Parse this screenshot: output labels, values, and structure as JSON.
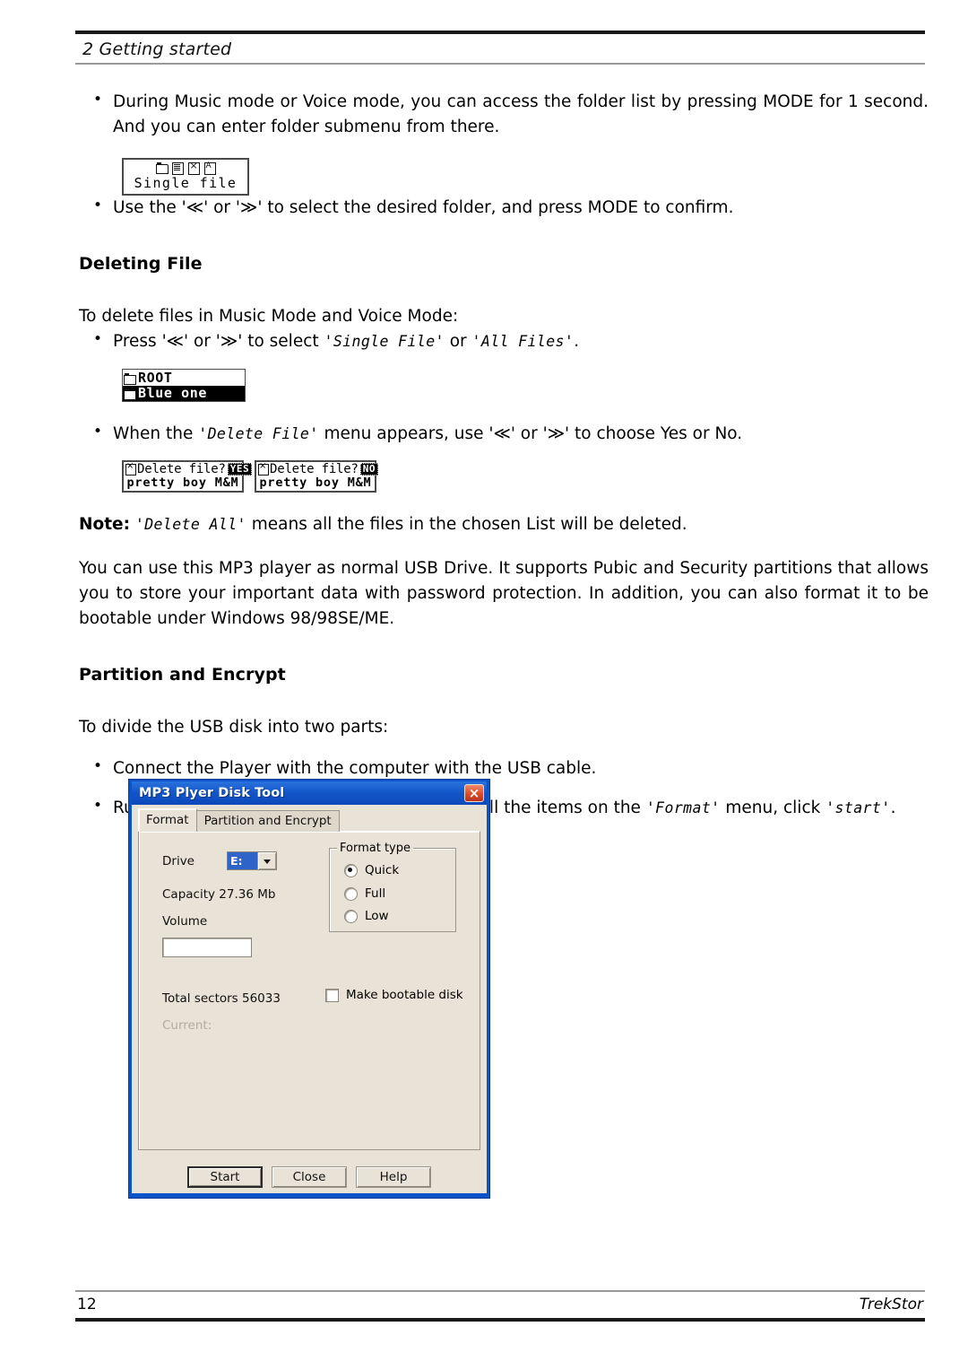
{
  "header": {
    "chapter_title": "2  Getting started"
  },
  "footer": {
    "page_number": "12",
    "brand": "TrekStor"
  },
  "body": {
    "bullet_folder_list_1": "During Music mode or Voice mode, you can access the folder list by pressing MODE for 1 second. And you can enter folder submenu from there.",
    "bullet_select_folder": "Use the '≪' or '≫' to select the desired folder, and press MODE to confirm.",
    "heading_deleting_file": "Deleting File",
    "intro_delete": "To delete files in Music Mode and Voice Mode:",
    "bullet_press_select_pre": "Press '≪' or '≫' to select ",
    "bullet_press_single_file": "'Single File'",
    "bullet_press_or": " or ",
    "bullet_press_all_files": "'All Files'",
    "bullet_press_end": ".",
    "bullet_delete_menu_pre": "When the ",
    "bullet_delete_menu_mono": "'Delete File'",
    "bullet_delete_menu_post": " menu appears, use '≪' or '≫' to choose Yes or No.",
    "note_label": "Note:",
    "note_mono": "'Delete All'",
    "note_rest": " means all the files in the chosen List will be deleted.",
    "usb_paragraph": "You can use this MP3 player as normal USB Drive. It supports Pubic and Security partitions that allows you to store your important data with password protection. In addition, you can also format it to be bootable under Windows 98/98SE/ME.",
    "heading_partition_encrypt": "Partition and Encrypt",
    "intro_divide": "To divide the USB disk into two parts:",
    "bullet_connect": "Connect the Player with the computer with the USB cable.",
    "bullet_run_tool_pre": "Run the MP3 Player Disk Tool. After filling in all the items on the ",
    "bullet_run_tool_format": "'Format'",
    "bullet_run_tool_mid": " menu, click ",
    "bullet_run_tool_start": "'start'",
    "bullet_run_tool_end": "."
  },
  "lcd_folder_list": {
    "caption": "Single file",
    "icons": [
      "folder-icon",
      "document-icon",
      "document-x-icon",
      "document-a-icon"
    ]
  },
  "lcd_root": {
    "root_label": "ROOT",
    "selected_label": "Blue one"
  },
  "lcd_delete_yes": {
    "prompt": "Delete file?",
    "choice": "YES",
    "track": "pretty boy M&M"
  },
  "lcd_delete_no": {
    "prompt": "Delete file?",
    "choice": "NO",
    "track": "pretty boy M&M"
  },
  "dialog": {
    "title": "MP3 Plyer Disk Tool",
    "close_glyph": "×",
    "tabs": [
      {
        "label": "Format",
        "active": true
      },
      {
        "label": "Partition and Encrypt",
        "active": false
      }
    ],
    "drive_label": "Drive",
    "drive_value": "E:",
    "capacity": "Capacity 27.36 Mb",
    "volume_label": "Volume",
    "volume_value": "",
    "volume_placeholder": "",
    "total_sectors": "Total sectors 56033",
    "current_label": "Current:",
    "format_type_title": "Format type",
    "format_type_options": [
      {
        "label": "Quick",
        "selected": true
      },
      {
        "label": "Full",
        "selected": false
      },
      {
        "label": "Low",
        "selected": false
      }
    ],
    "bootable_label": "Make bootable disk",
    "bootable_checked": false,
    "buttons": {
      "start": "Start",
      "close": "Close",
      "help": "Help"
    },
    "colors": {
      "titlebar": "#1255c8",
      "face": "#e8e3d6",
      "selection": "#2f63c8",
      "close_button": "#dd4a2a"
    }
  }
}
